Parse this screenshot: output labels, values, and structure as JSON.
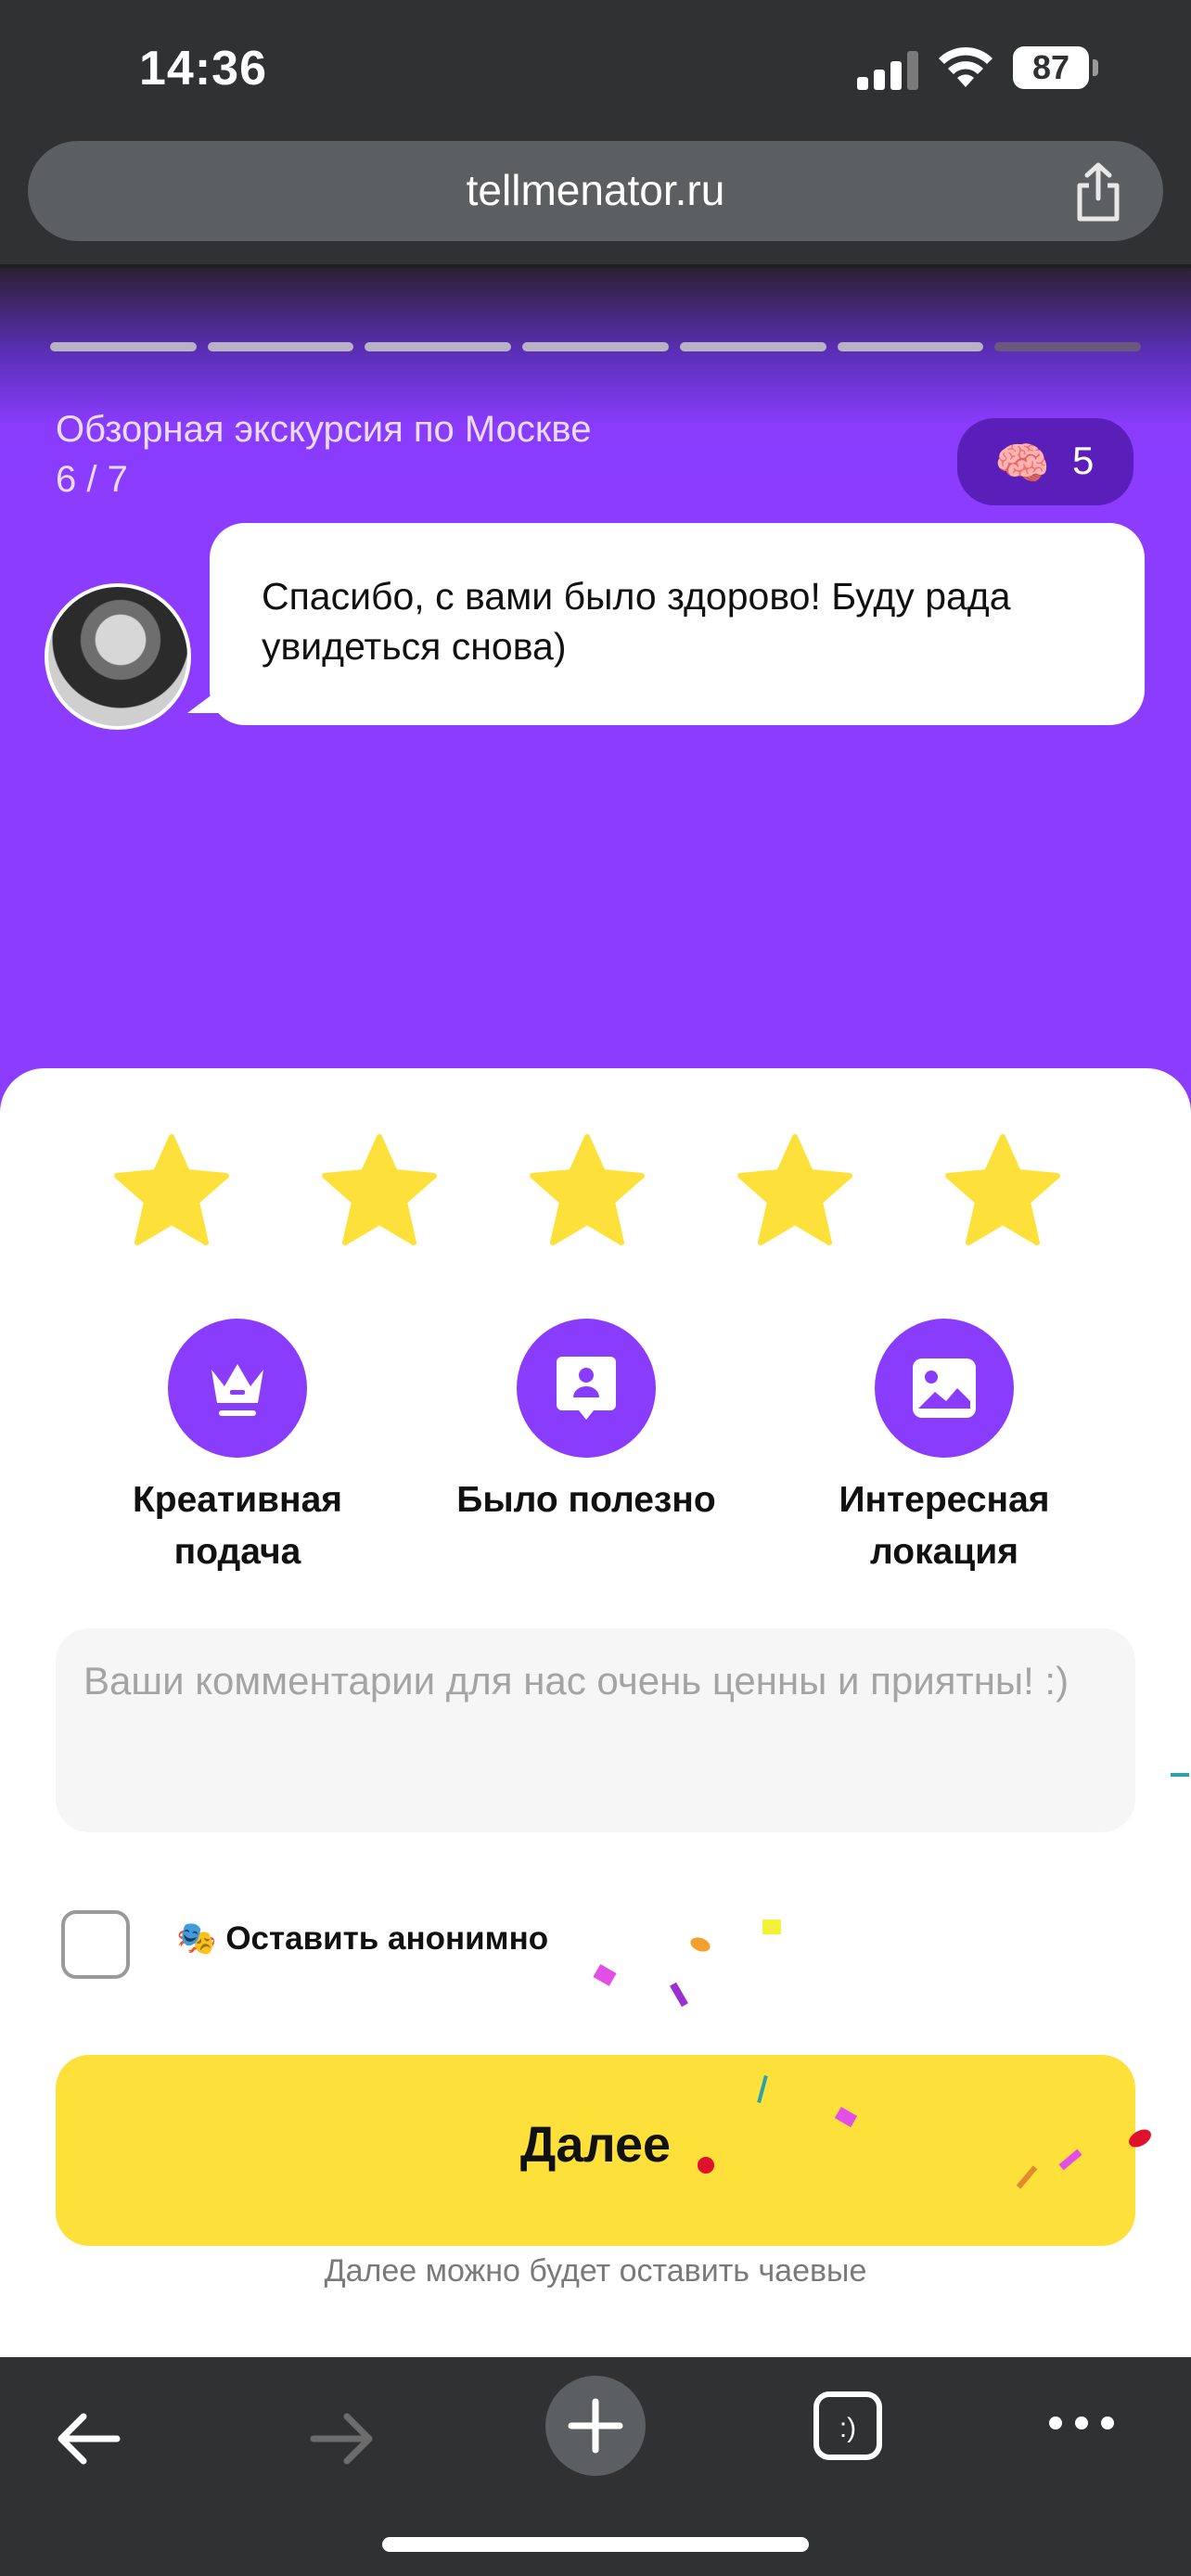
{
  "status_bar": {
    "time": "14:36",
    "battery": "87"
  },
  "browser": {
    "url": "tellmenator.ru"
  },
  "story": {
    "progress_total": 7,
    "progress_done": 6,
    "tour_title": "Обзорная экскурсия по Москве",
    "tour_step": "6 / 7",
    "brain_count": "5",
    "message": "Спасибо, с вами было здорово! Буду рада увидеться снова)"
  },
  "rating": {
    "value": 5,
    "max": 5,
    "color": "#fde13a"
  },
  "features": [
    {
      "label": "Креативная подача",
      "icon": "crown-icon"
    },
    {
      "label": "Было полезно",
      "icon": "profile-card-icon"
    },
    {
      "label": "Интересная локация",
      "icon": "image-icon"
    }
  ],
  "comment": {
    "placeholder": "Ваши комментарии для нас очень ценны и приятны! :)"
  },
  "anonymous": {
    "label": "Оставить анонимно",
    "checked": false
  },
  "next_button": {
    "label": "Далее"
  },
  "tips_note": "Далее можно будет оставить чаевые",
  "colors": {
    "accent": "#8a3cfd",
    "button": "#fde13a"
  }
}
